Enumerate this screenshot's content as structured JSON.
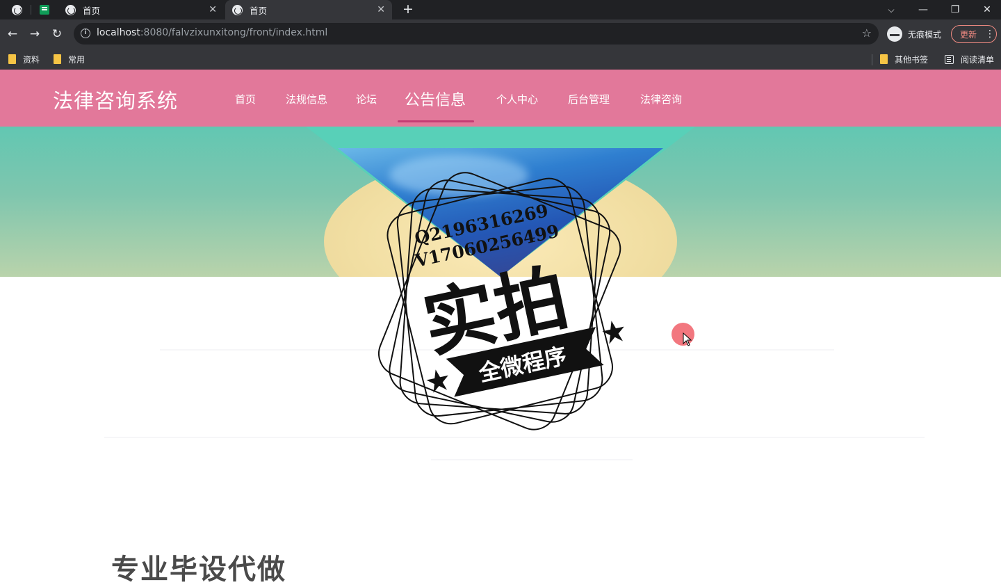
{
  "browser": {
    "tabs": [
      {
        "title": "首页",
        "active": false
      },
      {
        "title": "首页",
        "active": true
      }
    ],
    "close_glyph": "✕",
    "new_tab_glyph": "+",
    "window_controls": {
      "tablist": "⌵",
      "minimize": "—",
      "restore": "❐",
      "close": "✕"
    },
    "nav": {
      "back": "←",
      "forward": "→",
      "reload": "↻"
    },
    "url": {
      "host": "localhost",
      "rest": ":8080/falvzixunxitong/front/index.html"
    },
    "star": "☆",
    "incognito_label": "无痕模式",
    "update_label": "更新",
    "menu_glyph": "⋮",
    "bookmarks": [
      "资料",
      "常用"
    ],
    "bookmarks_right": [
      "其他书签",
      "阅读清单"
    ]
  },
  "site": {
    "title": "法律咨询系统",
    "nav": [
      {
        "label": "首页",
        "active": false
      },
      {
        "label": "法规信息",
        "active": false
      },
      {
        "label": "论坛",
        "active": false
      },
      {
        "label": "公告信息",
        "active": true
      },
      {
        "label": "个人中心",
        "active": false
      },
      {
        "label": "后台管理",
        "active": false
      },
      {
        "label": "法律咨询",
        "active": false
      }
    ],
    "partial_heading": "专业毕设代做",
    "header_color": "#e2789a",
    "active_underline_color": "#c43d74"
  },
  "watermark": {
    "line1": "Q2196316269",
    "line2": "V17060256499",
    "big_text": "实拍",
    "ribbon_text": "全微程序"
  }
}
